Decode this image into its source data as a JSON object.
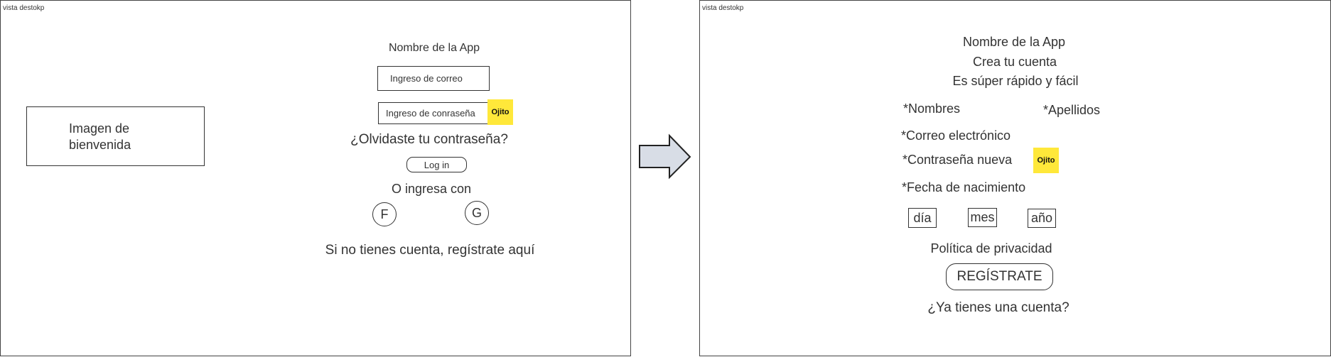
{
  "left_frame": {
    "tag": "vista destokp",
    "welcome_image": {
      "line1": "Imagen de",
      "line2": "bienvenida"
    },
    "app_name": "Nombre de la App",
    "email_input": "Ingreso de correo",
    "password_input": "Ingreso de conraseña",
    "eye_sticky": "Ojito",
    "forgot_password": "¿Olvidaste tu contraseña?",
    "login_button": "Log in",
    "or_login_with": "O ingresa con",
    "facebook_button": "F",
    "google_button": "G",
    "register_link": "Si no tienes cuenta, regístrate aquí"
  },
  "arrow": {
    "icon": "right-arrow-icon",
    "fill": "#d8dde6"
  },
  "right_frame": {
    "tag": "vista destokp",
    "app_name": "Nombre de la App",
    "subtitle": "Crea tu cuenta",
    "tagline": "Es súper rápido y fácil",
    "first_names": "*Nombres",
    "last_names": "*Apellidos",
    "email": "*Correo electrónico",
    "new_password": "*Contraseña nueva",
    "eye_sticky": "Ojito",
    "birth_date": "*Fecha de nacimiento",
    "day": "día",
    "month": "mes",
    "year": "año",
    "privacy_policy": "Política de privacidad",
    "register_button": "REGÍSTRATE",
    "have_account": "¿Ya tienes una cuenta?"
  },
  "colors": {
    "sticky": "#ffe83a",
    "stroke": "#333333"
  }
}
